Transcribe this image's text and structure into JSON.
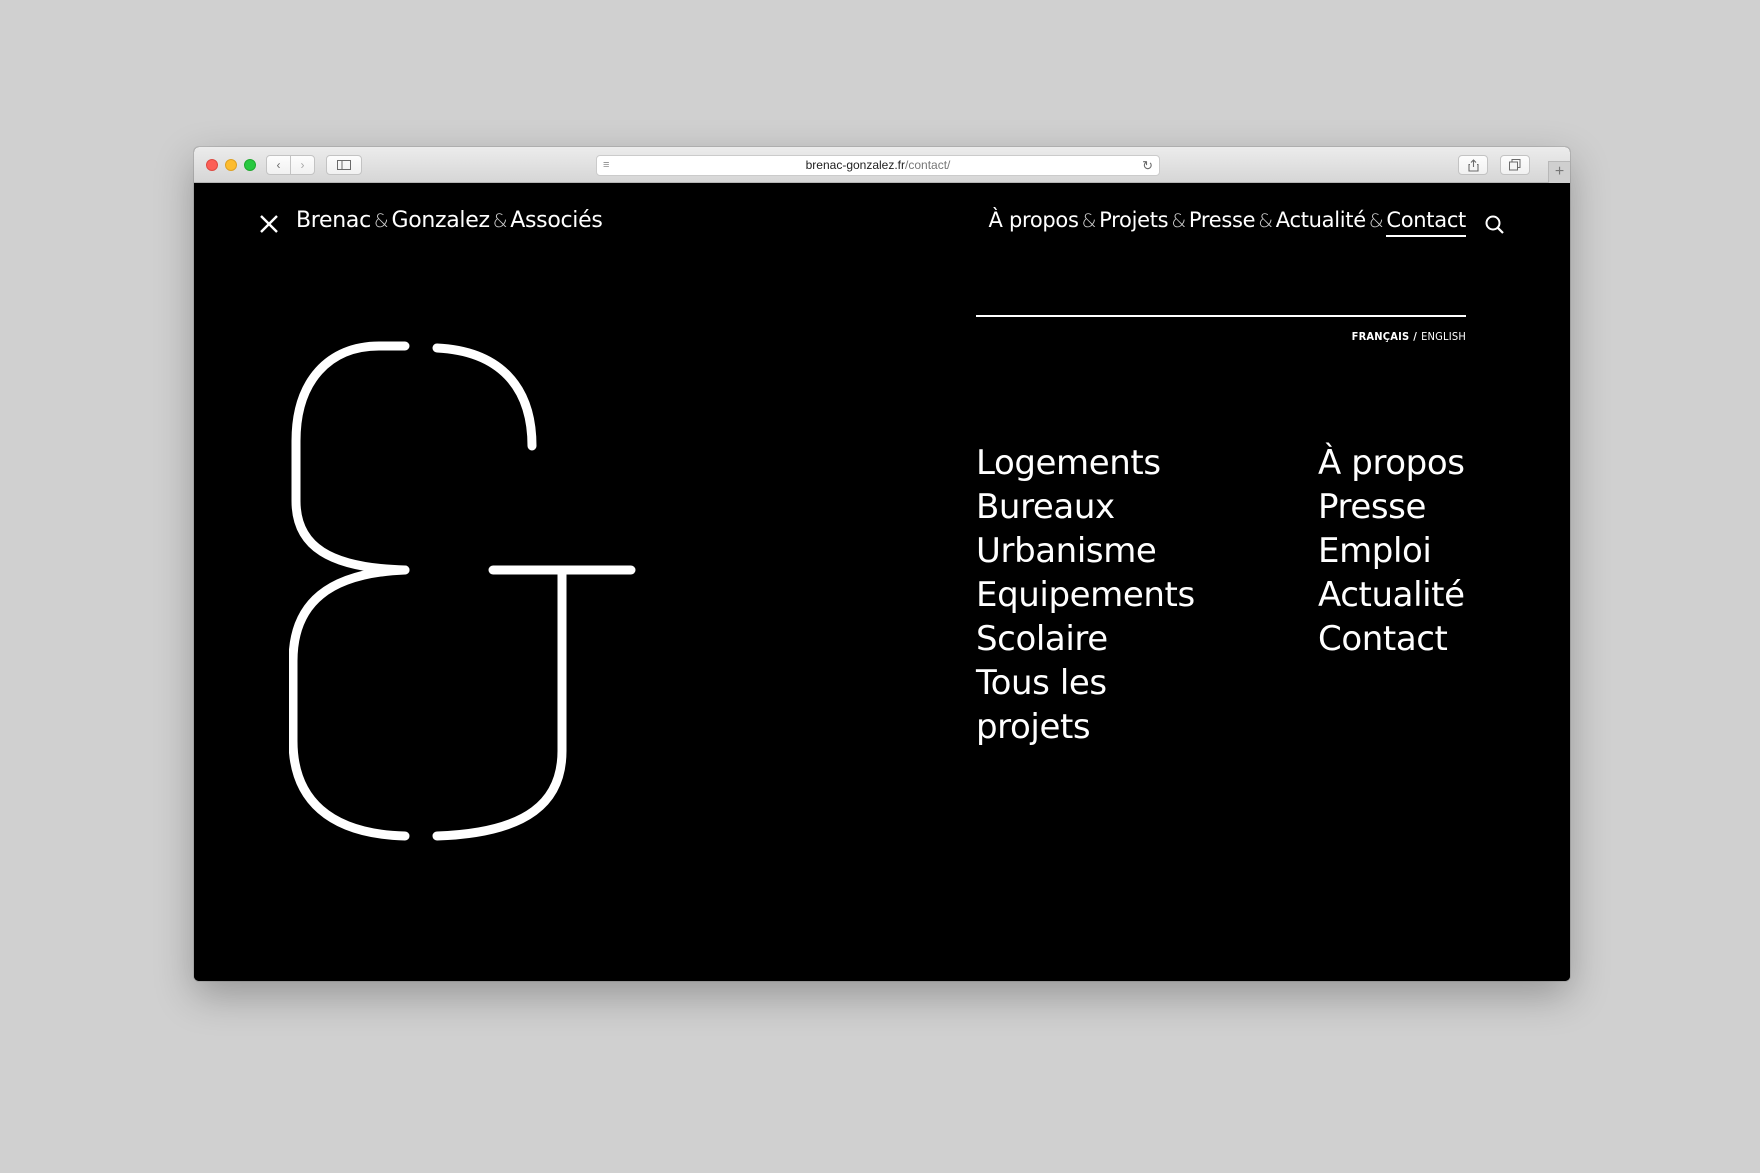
{
  "browser": {
    "url_host": "brenac-gonzalez.fr",
    "url_path": "/contact/"
  },
  "site": {
    "logo_parts": [
      "Brenac",
      "Gonzalez",
      "Associés"
    ],
    "amp": "&"
  },
  "nav": {
    "items": [
      "À propos",
      "Projets",
      "Presse",
      "Actualité",
      "Contact"
    ],
    "active": "Contact"
  },
  "language": {
    "fr": "FRANÇAIS",
    "separator": "/",
    "en": "ENGLISH"
  },
  "menu": {
    "projects": [
      "Logements",
      "Bureaux",
      "Urbanisme",
      "Equipements",
      "Scolaire",
      "Tous les projets"
    ],
    "pages": [
      "À propos",
      "Presse",
      "Emploi",
      "Actualité",
      "Contact"
    ]
  },
  "icons": {
    "close": "close-icon",
    "search": "search-icon",
    "ampersand": "ampersand-logo-icon"
  }
}
